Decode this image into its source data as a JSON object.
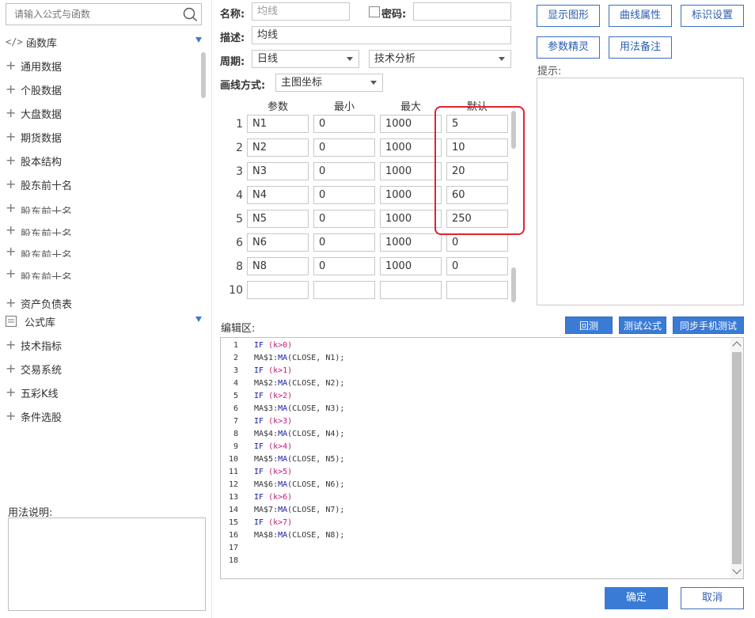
{
  "left_panel": {
    "search_placeholder": "请输入公式与函数",
    "function_lib": "函数库",
    "function_items": [
      "通用数据",
      "个股数据",
      "大盘数据",
      "期货数据",
      "股本结构",
      "股东前十名",
      "股东前十名",
      "股东前十名",
      "股东前十名",
      "股东前十名",
      "资产负债表"
    ],
    "formula_lib": "公式库",
    "formula_items": [
      "技术指标",
      "交易系统",
      "五彩K线",
      "条件选股"
    ],
    "usage_label": "用法说明:"
  },
  "form": {
    "name_label": "名称:",
    "name_value": "均线",
    "password_label": "密码:",
    "desc_label": "描述:",
    "desc_value": "均线",
    "period_label": "周期:",
    "period_value": "日线",
    "category_value": "技术分析",
    "draw_label": "画线方式:",
    "draw_value": "主图坐标"
  },
  "params": {
    "headers": [
      "参数",
      "最小",
      "最大",
      "默认"
    ],
    "rows": [
      {
        "num": "1",
        "name": "N1",
        "min": "0",
        "max": "1000",
        "default": "5"
      },
      {
        "num": "2",
        "name": "N2",
        "min": "0",
        "max": "1000",
        "default": "10"
      },
      {
        "num": "3",
        "name": "N3",
        "min": "0",
        "max": "1000",
        "default": "20"
      },
      {
        "num": "4",
        "name": "N4",
        "min": "0",
        "max": "1000",
        "default": "60"
      },
      {
        "num": "5",
        "name": "N5",
        "min": "0",
        "max": "1000",
        "default": "250"
      },
      {
        "num": "6",
        "name": "N6",
        "min": "0",
        "max": "1000",
        "default": "0"
      },
      {
        "num": "8",
        "name": "N8",
        "min": "0",
        "max": "1000",
        "default": "0"
      },
      {
        "num": "10",
        "name": "",
        "min": "",
        "max": "",
        "default": ""
      }
    ]
  },
  "right_buttons": {
    "show_graph": "显示图形",
    "line_props": "曲线属性",
    "marker_settings": "标识设置",
    "param_wizard": "参数精灵",
    "usage_notes": "用法备注",
    "hint_label": "提示:"
  },
  "editor": {
    "label": "编辑区:",
    "backtest": "回测",
    "test_formula": "测试公式",
    "sync_mobile": "同步手机测试",
    "lines": [
      {
        "n": "1",
        "kw": "IF",
        "rest": " (k>0)"
      },
      {
        "n": "2",
        "code": "MA$1:MA(CLOSE, N1);"
      },
      {
        "n": "3",
        "kw": "IF",
        "rest": " (k>1)"
      },
      {
        "n": "4",
        "code": "MA$2:MA(CLOSE, N2);"
      },
      {
        "n": "5",
        "kw": "IF",
        "rest": " (k>2)"
      },
      {
        "n": "6",
        "code": "MA$3:MA(CLOSE, N3);"
      },
      {
        "n": "7",
        "kw": "IF",
        "rest": " (k>3)"
      },
      {
        "n": "8",
        "code": "MA$4:MA(CLOSE, N4);"
      },
      {
        "n": "9",
        "kw": "IF",
        "rest": " (k>4)"
      },
      {
        "n": "10",
        "code": "MA$5:MA(CLOSE, N5);"
      },
      {
        "n": "11",
        "kw": "IF",
        "rest": " (k>5)"
      },
      {
        "n": "12",
        "code": "MA$6:MA(CLOSE, N6);"
      },
      {
        "n": "13",
        "kw": "IF",
        "rest": " (k>6)"
      },
      {
        "n": "14",
        "code": "MA$7:MA(CLOSE, N7);"
      },
      {
        "n": "15",
        "kw": "IF",
        "rest": " (k>7)"
      },
      {
        "n": "16",
        "code": "MA$8:MA(CLOSE, N8);"
      },
      {
        "n": "17",
        "code": ""
      },
      {
        "n": "18",
        "code": ""
      }
    ]
  },
  "footer": {
    "ok": "确定",
    "cancel": "取消"
  },
  "colors": {
    "accent": "#3a7bd5",
    "highlight": "#e0232f"
  }
}
